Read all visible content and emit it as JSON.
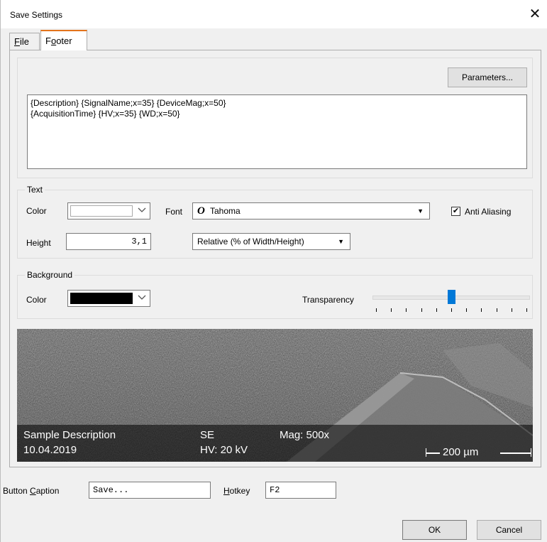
{
  "window": {
    "title": "Save Settings",
    "close_glyph": "✕"
  },
  "tabs": [
    {
      "label_hot": "F",
      "label_rest": "ile"
    },
    {
      "label_pre": "F",
      "label_hot": "o",
      "label_rest": "oter"
    }
  ],
  "footer": {
    "parameters_button": "Parameters...",
    "template_text": "{Description} {SignalName;x=35} {DeviceMag;x=50}\n{AcquisitionTime} {HV;x=35} {WD;x=50}"
  },
  "text_group": {
    "legend": "Text",
    "color_label": "Color",
    "color_value": "#ffffff",
    "font_label": "Font",
    "font_icon": "O",
    "font_value": "Tahoma",
    "anti_aliasing_label": "Anti Aliasing",
    "anti_aliasing_checked": true,
    "check_glyph": "✔",
    "height_label": "Height",
    "height_value": "3,1",
    "unit_value": "Relative (% of Width/Height)"
  },
  "background_group": {
    "legend": "Background",
    "color_label": "Color",
    "color_value": "#000000",
    "transparency_label": "Transparency",
    "transparency_level": 0.5
  },
  "preview": {
    "description": "Sample Description",
    "date": "10.04.2019",
    "signal": "SE",
    "hv": "HV: 20 kV",
    "mag": "Mag: 500x",
    "scale": "200 µm"
  },
  "bottom": {
    "caption_label_pre": "Button ",
    "caption_label_hot": "C",
    "caption_label_rest": "aption",
    "caption_value": "Save...",
    "hotkey_label_hot": "H",
    "hotkey_label_rest": "otkey",
    "hotkey_value": "F2",
    "ok_label": "OK",
    "cancel_label": "Cancel"
  },
  "icons": {
    "close": "close-icon",
    "chevron": "chevron-down-icon",
    "font": "opentype-font-icon",
    "dropdown": "dropdown-arrow-icon"
  },
  "colors": {
    "accent_tab": "#e3741c",
    "slider_thumb": "#0078d7"
  }
}
